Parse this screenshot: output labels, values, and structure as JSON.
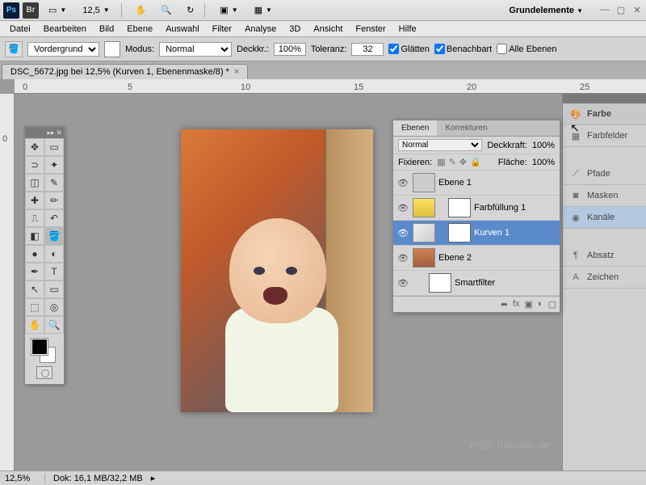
{
  "titlebar": {
    "ps": "Ps",
    "br": "Br",
    "zoom_pct": "12,5",
    "workspace": "Grundelemente"
  },
  "menu": [
    "Datei",
    "Bearbeiten",
    "Bild",
    "Ebene",
    "Auswahl",
    "Filter",
    "Analyse",
    "3D",
    "Ansicht",
    "Fenster",
    "Hilfe"
  ],
  "options": {
    "fill_target": "Vordergrund",
    "mode_label": "Modus:",
    "mode_value": "Normal",
    "opacity_label": "Deckkr.:",
    "opacity_value": "100%",
    "tolerance_label": "Toleranz:",
    "tolerance_value": "32",
    "antialias": "Glätten",
    "contiguous": "Benachbart",
    "all_layers": "Alle Ebenen"
  },
  "doc_tab": {
    "title": "DSC_5672.jpg bei 12,5% (Kurven 1, Ebenenmaske/8) *"
  },
  "ruler_h": [
    "0",
    "5",
    "10",
    "15",
    "20",
    "25"
  ],
  "ruler_v": [
    "0"
  ],
  "layers_panel": {
    "tabs": [
      "Ebenen",
      "Korrekturen"
    ],
    "blend_mode": "Normal",
    "opacity_label": "Deckkraft:",
    "opacity_value": "100%",
    "lock_label": "Fixieren:",
    "fill_label": "Fläche:",
    "fill_value": "100%",
    "layers": [
      {
        "name": "Ebene 1",
        "type": "plain"
      },
      {
        "name": "Farbfüllung 1",
        "type": "fill"
      },
      {
        "name": "Kurven 1",
        "type": "curves",
        "selected": true
      },
      {
        "name": "Ebene 2",
        "type": "image"
      },
      {
        "name": "Smartfilter",
        "type": "smart"
      }
    ]
  },
  "right_dock": {
    "items": [
      {
        "label": "Farbe",
        "icon": "palette",
        "header": true
      },
      {
        "label": "Farbfelder",
        "icon": "swatches"
      },
      {
        "label": "",
        "icon": "",
        "spacer": true
      },
      {
        "label": "Pfade",
        "icon": "paths"
      },
      {
        "label": "Masken",
        "icon": "masks"
      },
      {
        "label": "Kanäle",
        "icon": "channels",
        "active": true
      },
      {
        "label": "",
        "icon": "",
        "spacer": true
      },
      {
        "label": "Absatz",
        "icon": "paragraph"
      },
      {
        "label": "Zeichen",
        "icon": "character"
      }
    ]
  },
  "status": {
    "zoom": "12,5%",
    "doc_size_label": "Dok:",
    "doc_size": "16,1 MB/32,2 MB"
  },
  "watermark": "PSD-Tutorials.de"
}
